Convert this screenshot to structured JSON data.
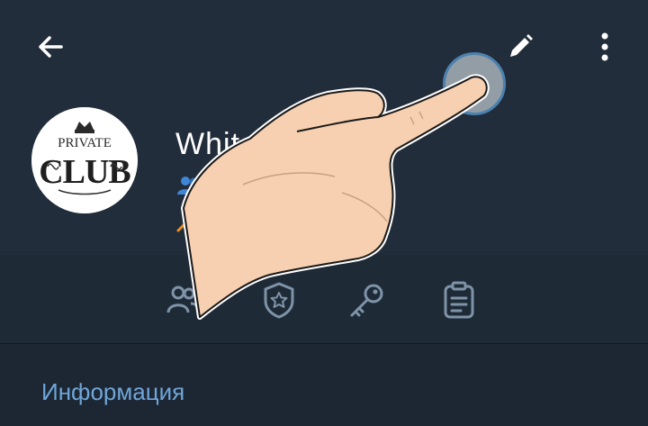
{
  "app": {
    "title": "Whit",
    "avatar_text": "PRIVATE CLUB"
  },
  "toolbar": {
    "back_icon": "arrow-left-icon",
    "edit_icon": "pencil-icon",
    "menu_icon": "more-vertical-icon"
  },
  "tabs": [
    {
      "icon": "members-icon"
    },
    {
      "icon": "admins-shield-star-icon"
    },
    {
      "icon": "permissions-key-icon"
    },
    {
      "icon": "recent-actions-clipboard-icon"
    }
  ],
  "info": {
    "section_title": "Информация"
  },
  "colors": {
    "header_bg": "#222d3b",
    "body_bg": "#1d2733",
    "accent": "#6fa6d9",
    "icon": "#7f93a8"
  }
}
